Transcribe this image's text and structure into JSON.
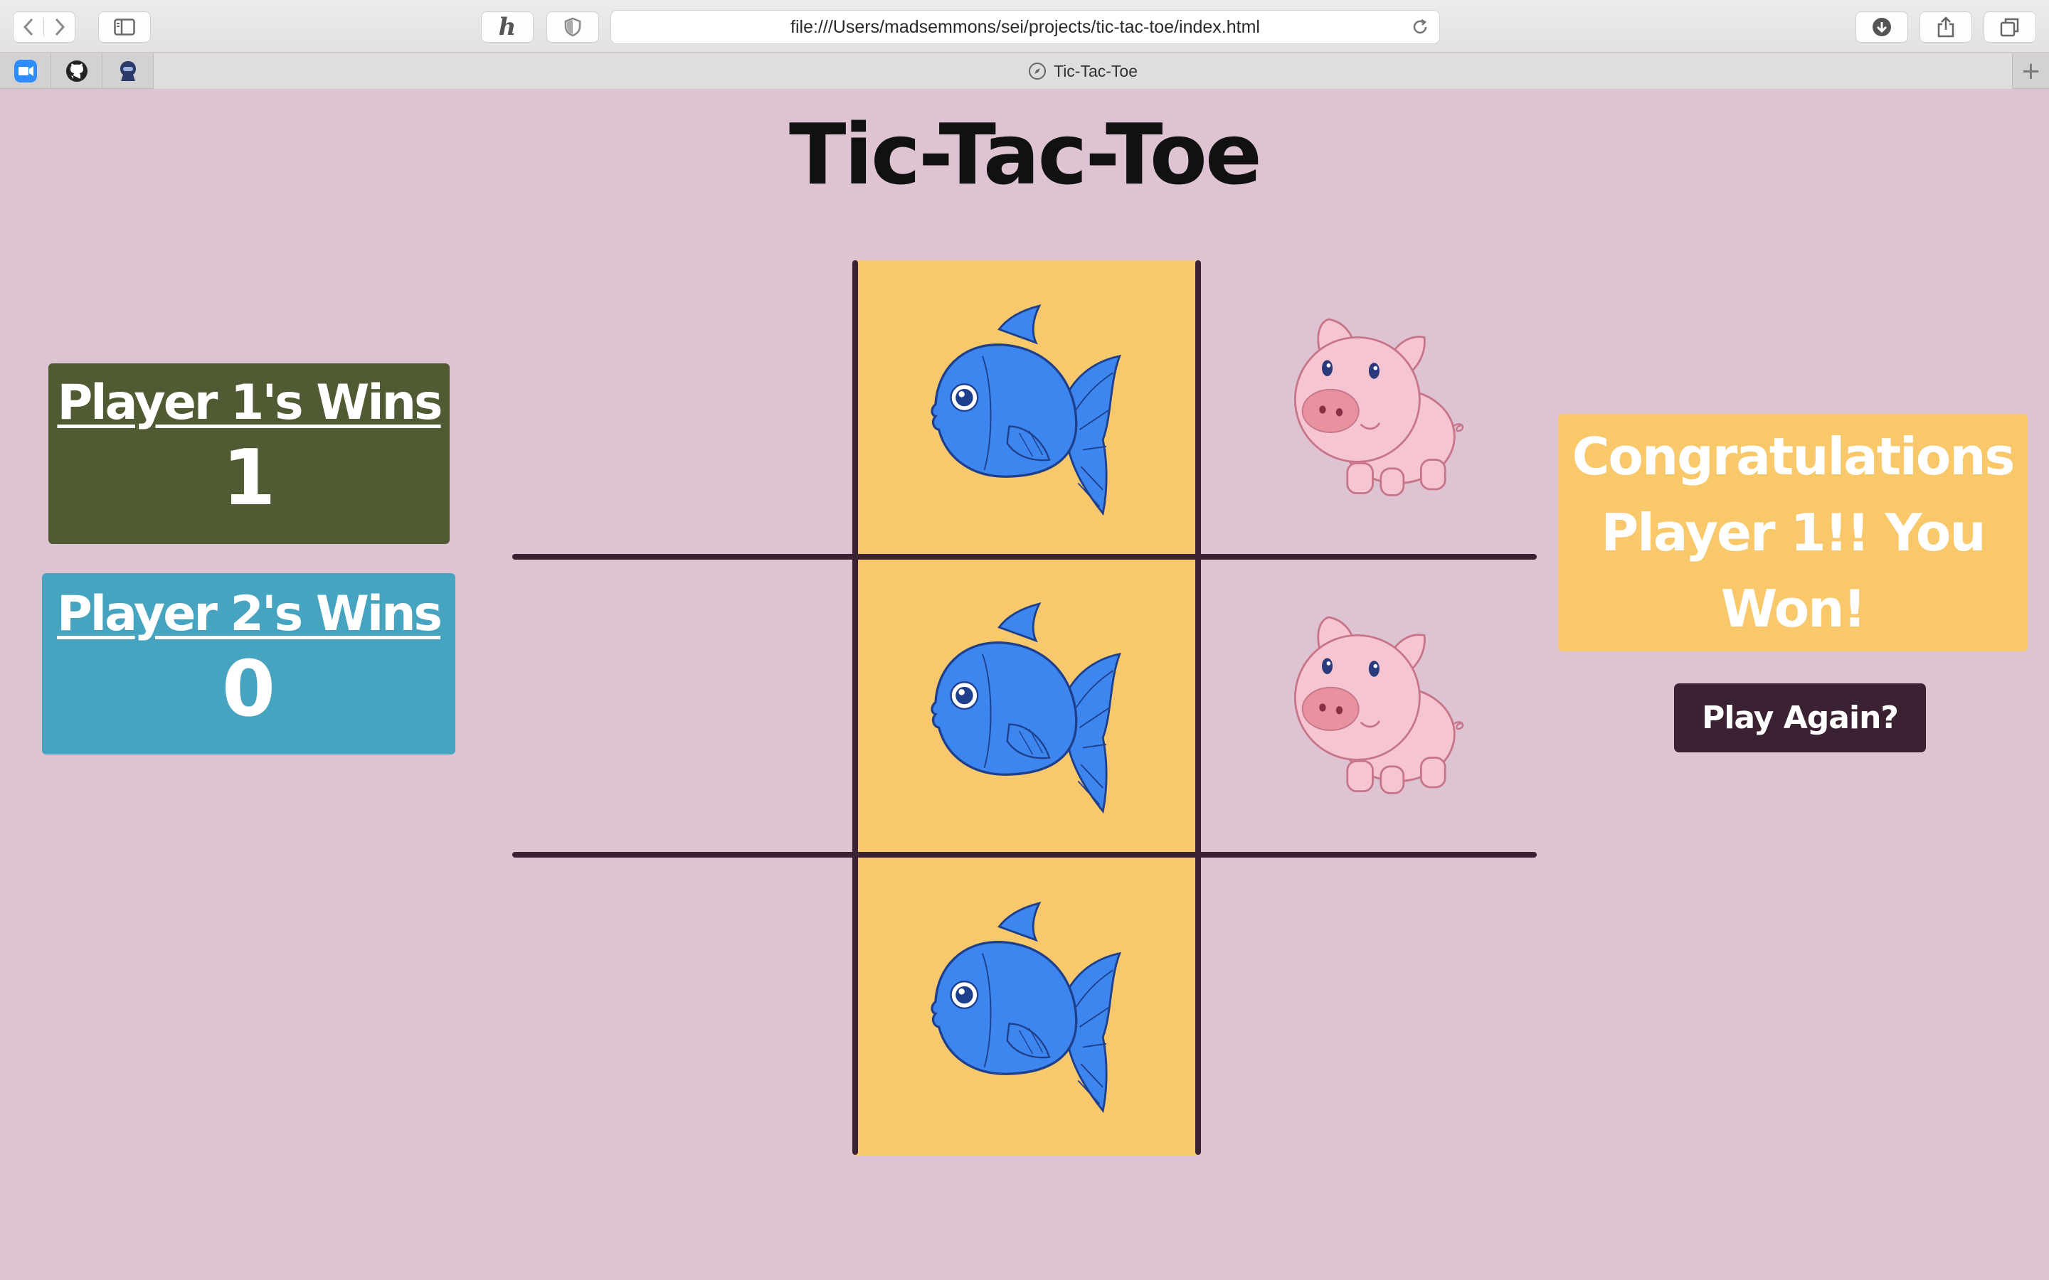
{
  "browser": {
    "url": "file:///Users/madsemmons/sei/projects/tic-tac-toe/index.html",
    "tab_title": "Tic-Tac-Toe",
    "pinned_tabs": [
      "video-icon",
      "github-icon",
      "profile-icon"
    ]
  },
  "page": {
    "title": "Tic-Tac-Toe",
    "player1": {
      "label": "Player 1's Wins",
      "wins": "1"
    },
    "player2": {
      "label": "Player 2's Wins",
      "wins": "0"
    },
    "message": "Congratulations Player 1!! You Won!",
    "play_again": "Play Again?"
  },
  "board": [
    [
      "",
      "fish",
      "pig"
    ],
    [
      "",
      "fish",
      "pig"
    ],
    [
      "",
      "fish",
      "",
      ""
    ]
  ],
  "colors": {
    "background": "#dec3d2",
    "player1_panel": "#515b33",
    "player2_panel": "#47a4c0",
    "message_panel": "#f8c86b",
    "button": "#3b2232",
    "grid_lines": "#3b2232",
    "winning_cell": "#f7c86c"
  }
}
